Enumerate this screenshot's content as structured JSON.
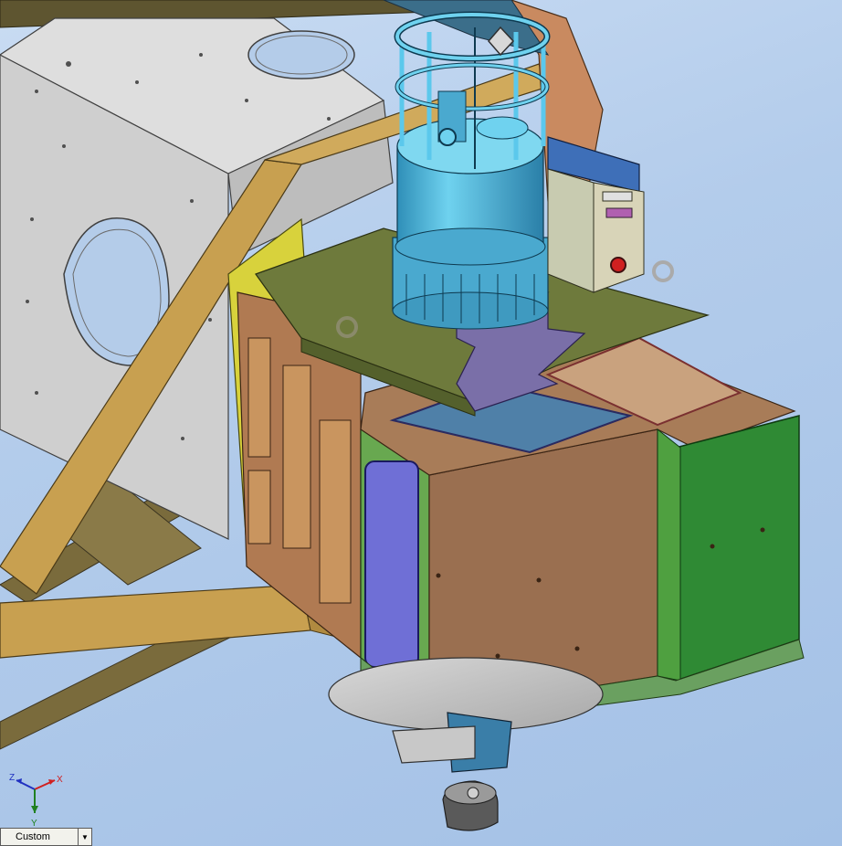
{
  "view": {
    "orientation_label": "Custom",
    "dropdown_icon": "chevron-down-icon"
  },
  "triad": {
    "x_label": "X",
    "y_label": "Y",
    "z_label": "Z"
  },
  "colors": {
    "background_top": "#c9dcf3",
    "background_bottom": "#a4c1e6",
    "frame_tube": "#c8a050",
    "housing_brown": "#9a6f50",
    "panel_green": "#2f8a34",
    "plate_olive": "#6e7a3c",
    "cylinder_cyan": "#4fb6d8",
    "window_blue": "#6f6fd6",
    "enclosure_grey": "#c8c8c8"
  }
}
